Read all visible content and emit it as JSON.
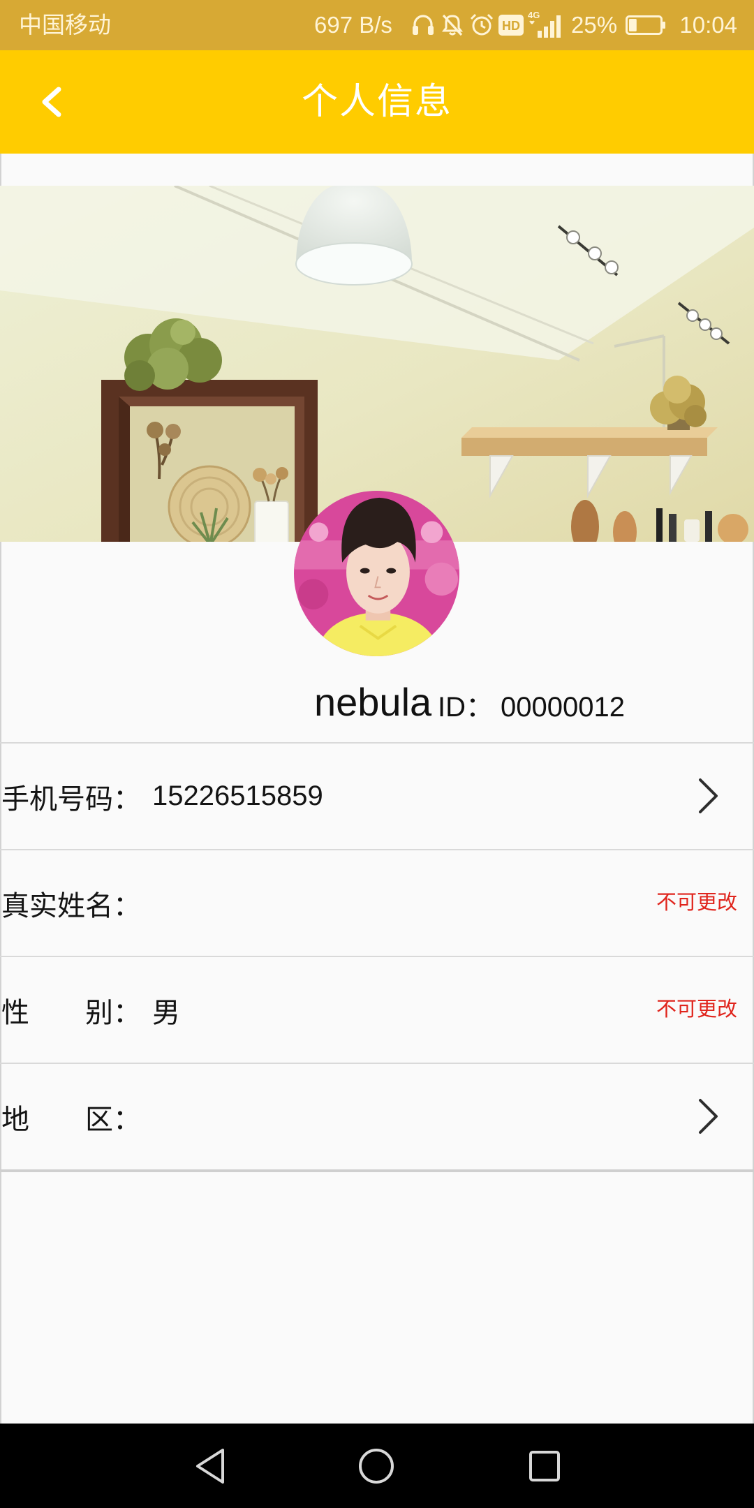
{
  "status_bar": {
    "carrier": "中国移动",
    "net_speed": "697 B/s",
    "hd_badge": "HD",
    "network_type": "4G",
    "battery_text": "25%",
    "battery_level": 0.25,
    "time": "10:04",
    "icons": [
      "headphones-icon",
      "mute-icon",
      "alarm-icon",
      "hd-icon",
      "signal-icon",
      "battery-icon"
    ]
  },
  "header": {
    "title": "个人信息",
    "back_icon": "chevron-left-icon"
  },
  "profile": {
    "banner": "room-interior-photo",
    "avatar": "avatar-photo",
    "username": "nebula",
    "id_label": "ID：",
    "id_value": "00000012"
  },
  "rows": [
    {
      "label": "手机号码：",
      "value": "15226515859",
      "action_icon": "chevron-right-icon"
    },
    {
      "label": "真实姓名：",
      "value": "",
      "note": "不可更改"
    },
    {
      "label": "性　　别：",
      "value": "男",
      "note": "不可更改"
    },
    {
      "label": "地　　区：",
      "value": "",
      "action_icon": "chevron-right-icon"
    }
  ],
  "nav_bar": {
    "icons": [
      "back-triangle-icon",
      "home-circle-icon",
      "recents-square-icon"
    ]
  },
  "colors": {
    "status-bg": "#D7A934",
    "header-bg": "#FFCC00",
    "note": "#E0241C"
  }
}
